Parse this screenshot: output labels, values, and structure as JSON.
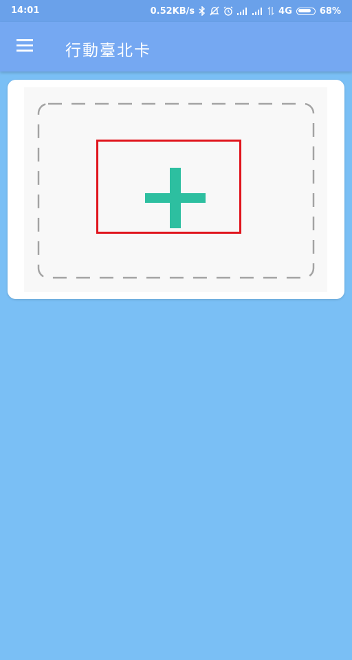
{
  "status_bar": {
    "time": "14:01",
    "speed": "0.52KB/s",
    "network": "4G",
    "battery": "68%",
    "icons": [
      "bluetooth-icon",
      "mute-icon",
      "alarm-icon",
      "signal-icon",
      "signal-icon",
      "signal-icon",
      "battery-icon"
    ]
  },
  "app_bar": {
    "title": "行動臺北卡",
    "menu_icon": "hamburger-menu-icon"
  },
  "card": {
    "add_icon": "plus-icon"
  },
  "colors": {
    "status_bar": "#6aa1ea",
    "app_bar": "#75a8f2",
    "background": "#7abff5",
    "plus": "#2dbfa0",
    "highlight": "#e0141c"
  }
}
